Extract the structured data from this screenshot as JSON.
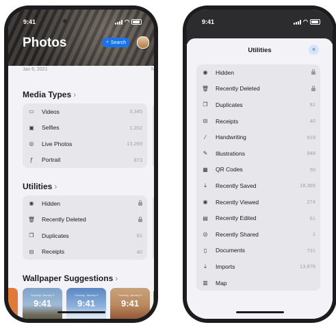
{
  "left_phone": {
    "status_time": "9:41",
    "title": "Photos",
    "search_label": "Search",
    "date_label": "Jan 6, 2021",
    "date_label_right": "N",
    "media_types": {
      "heading": "Media Types",
      "items": [
        {
          "icon": "video-icon",
          "glyph": "▭",
          "label": "Videos",
          "value": "3,345"
        },
        {
          "icon": "selfie-icon",
          "glyph": "▣",
          "label": "Selfies",
          "value": "1,202"
        },
        {
          "icon": "live-photo-icon",
          "glyph": "◎",
          "label": "Live Photos",
          "value": "13,269"
        },
        {
          "icon": "portrait-icon",
          "glyph": "ƒ",
          "label": "Portrait",
          "value": "873"
        }
      ]
    },
    "utilities": {
      "heading": "Utilities",
      "items": [
        {
          "icon": "eye-icon",
          "glyph": "◉",
          "label": "Hidden",
          "value": "",
          "locked": true
        },
        {
          "icon": "trash-icon",
          "glyph": "🗑",
          "label": "Recently Deleted",
          "value": "",
          "locked": true
        },
        {
          "icon": "duplicates-icon",
          "glyph": "❐",
          "label": "Duplicates",
          "value": "81"
        },
        {
          "icon": "receipt-icon",
          "glyph": "⊟",
          "label": "Receipts",
          "value": "40"
        }
      ]
    },
    "wallpaper": {
      "heading": "Wallpaper Suggestions",
      "cards": [
        {
          "time": "9:41",
          "sub": "Tuesday, January 9"
        },
        {
          "time": "9:41",
          "sub": "Tuesday, January 9"
        },
        {
          "time": "9:41",
          "sub": "Tuesday, January 9"
        }
      ]
    }
  },
  "right_phone": {
    "status_time": "9:41",
    "sheet_title": "Utilities",
    "close_label": "×",
    "items": [
      {
        "icon": "eye-icon",
        "glyph": "◉",
        "label": "Hidden",
        "value": "",
        "locked": true
      },
      {
        "icon": "trash-icon",
        "glyph": "🗑",
        "label": "Recently Deleted",
        "value": "",
        "locked": true
      },
      {
        "icon": "duplicates-icon",
        "glyph": "❐",
        "label": "Duplicates",
        "value": "81"
      },
      {
        "icon": "receipt-icon",
        "glyph": "⊟",
        "label": "Receipts",
        "value": "40"
      },
      {
        "icon": "handwriting-icon",
        "glyph": "⁄",
        "label": "Handwriting",
        "value": "919"
      },
      {
        "icon": "illustrations-icon",
        "glyph": "✎",
        "label": "Illustrations",
        "value": "948"
      },
      {
        "icon": "qr-code-icon",
        "glyph": "▦",
        "label": "QR Codes",
        "value": "50"
      },
      {
        "icon": "recently-saved-icon",
        "glyph": "⤓",
        "label": "Recently Saved",
        "value": "18,365"
      },
      {
        "icon": "recently-viewed-icon",
        "glyph": "◉",
        "label": "Recently Viewed",
        "value": "274"
      },
      {
        "icon": "recently-edited-icon",
        "glyph": "▤",
        "label": "Recently Edited",
        "value": "61"
      },
      {
        "icon": "recently-shared-icon",
        "glyph": "◎",
        "label": "Recently Shared",
        "value": "1"
      },
      {
        "icon": "documents-icon",
        "glyph": "▯",
        "label": "Documents",
        "value": "731"
      },
      {
        "icon": "imports-icon",
        "glyph": "⤓",
        "label": "Imports",
        "value": "13,876"
      },
      {
        "icon": "map-icon",
        "glyph": "▥",
        "label": "Map",
        "value": ""
      }
    ]
  },
  "colors": {
    "accent": "#1a73e8",
    "group_bg": "#e6e6eb",
    "screen_bg": "#f2f2f7"
  }
}
